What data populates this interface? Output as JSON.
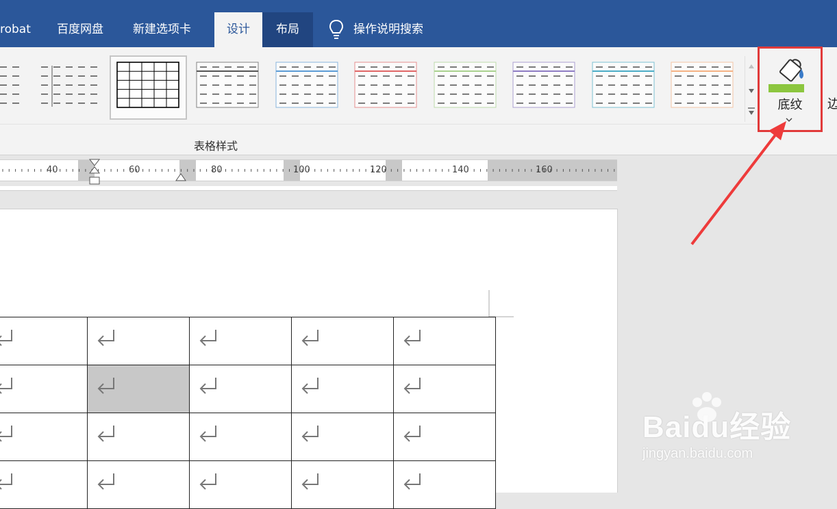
{
  "tabs": [
    {
      "label": "robat"
    },
    {
      "label": "百度网盘"
    },
    {
      "label": "新建选项卡"
    },
    {
      "label": "设计"
    },
    {
      "label": "布局"
    }
  ],
  "tell_me": {
    "label": "操作说明搜索",
    "icon": "lightbulb-icon"
  },
  "ribbon": {
    "group_label": "表格样式",
    "table_styles": [
      {
        "accent": "#888888"
      },
      {
        "accent": "#555555"
      },
      {
        "accent": "#000000"
      },
      {
        "accent": "#555555"
      },
      {
        "accent": "#5b9bd5"
      },
      {
        "accent": "#e06666"
      },
      {
        "accent": "#a9d18e"
      },
      {
        "accent": "#8e7cc3"
      },
      {
        "accent": "#4bacc6"
      },
      {
        "accent": "#f4b183"
      }
    ],
    "shading": {
      "label": "底纹",
      "icon": "paint-bucket-icon",
      "fill_color": "#8cc63f"
    },
    "borders_label_partial": "边"
  },
  "ruler": {
    "numbers": [
      "40",
      "60",
      "80",
      "100",
      "120",
      "140",
      "160"
    ]
  },
  "watermark": {
    "brand": "Baidu经验",
    "url": "jingyan.baidu.com"
  },
  "colors": {
    "title_bar": "#2b579a",
    "highlight": "#e13a3a"
  }
}
